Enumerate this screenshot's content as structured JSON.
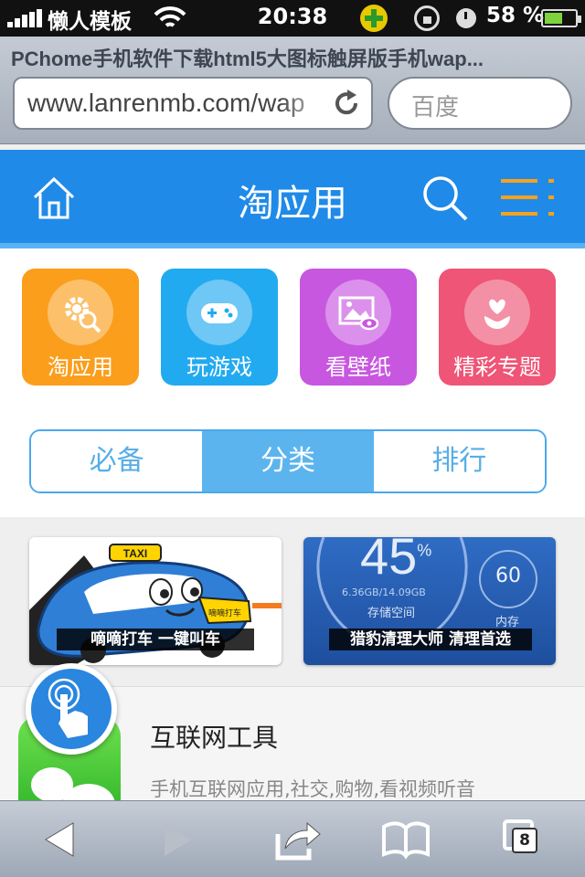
{
  "status_bar": {
    "carrier": "懒人模板",
    "time": "20:38",
    "battery_percent": "58 %",
    "battery_level": 0.58,
    "icons": [
      "signal-icon",
      "wifi-icon",
      "plus-badge-icon",
      "rotation-lock-icon",
      "alarm-icon",
      "battery-icon"
    ]
  },
  "browser": {
    "page_title": "PChome手机软件下载html5大图标触屏版手机wap...",
    "url": "www.lanrenmb.com/wap",
    "search_placeholder": "百度"
  },
  "header": {
    "title": "淘应用",
    "bg_color": "#1f8ae8"
  },
  "categories": [
    {
      "label": "淘应用",
      "color": "#fb9e1c",
      "icon": "gear-search-icon"
    },
    {
      "label": "玩游戏",
      "color": "#22aaf0",
      "icon": "gamepad-icon"
    },
    {
      "label": "看壁纸",
      "color": "#c857e0",
      "icon": "picture-icon"
    },
    {
      "label": "精彩专题",
      "color": "#ee5576",
      "icon": "flower-icon"
    }
  ],
  "tabs": [
    {
      "label": "必备",
      "active": false
    },
    {
      "label": "分类",
      "active": true
    },
    {
      "label": "排行",
      "active": false
    }
  ],
  "banners": [
    {
      "caption": "嘀嘀打车 一键叫车",
      "badge": "TAXI",
      "sign": "嘀嘀打车"
    },
    {
      "caption": "猎豹清理大师 清理首选",
      "gauge_value": "45",
      "gauge_unit": "%",
      "storage": "6.36GB/14.09GB",
      "storage_label": "存储空间",
      "memory_value": "60",
      "memory_label": "内存"
    }
  ],
  "list": [
    {
      "title": "互联网工具",
      "description": "手机互联网应用,社交,购物,看视频听音"
    }
  ],
  "toolbar": {
    "tabs_count": "8"
  }
}
